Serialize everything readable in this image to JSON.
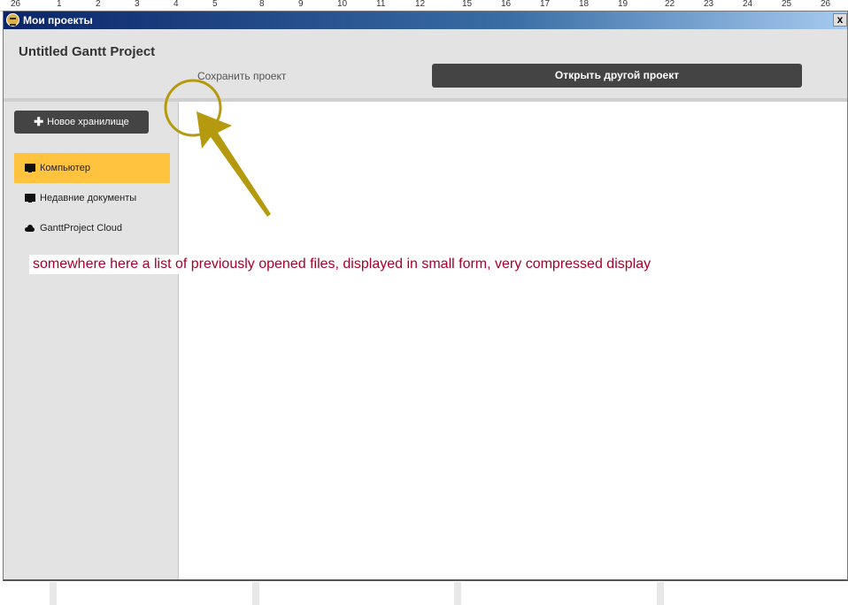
{
  "ruler": {
    "labels": [
      "26",
      "1",
      "2",
      "3",
      "4",
      "5",
      "8",
      "9",
      "10",
      "11",
      "12",
      "15",
      "16",
      "17",
      "18",
      "19",
      "22",
      "23",
      "24",
      "25",
      "26"
    ]
  },
  "window": {
    "title": "Мои проекты",
    "close_label": "x"
  },
  "header": {
    "project_title": "Untitled Gantt Project",
    "save_label": "Сохранить проект",
    "open_other_label": "Открыть другой проект"
  },
  "sidebar": {
    "new_storage_label": "Новое хранилище",
    "items": [
      {
        "label": "Компьютер",
        "icon": "monitor-icon",
        "active": true
      },
      {
        "label": "Недавние документы",
        "icon": "monitor-icon",
        "active": false
      },
      {
        "label": "GanttProject Cloud",
        "icon": "cloud-icon",
        "active": false
      }
    ]
  },
  "annotation": {
    "text": "somewhere here a list of previously opened files, displayed in small form, very compressed display",
    "text_color": "#a8002a",
    "arrow_color": "#b59a10"
  },
  "colors": {
    "accent": "#ffc33d",
    "dark_button": "#444444"
  }
}
